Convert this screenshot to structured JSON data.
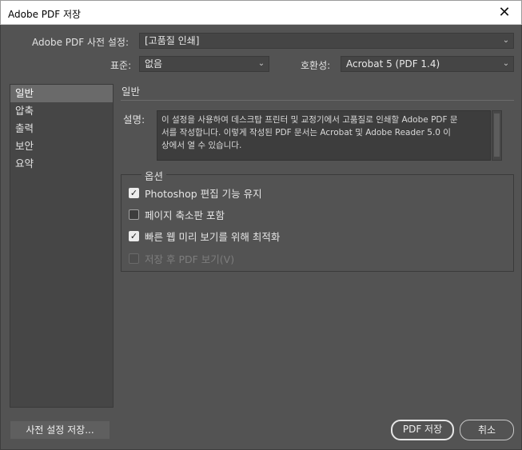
{
  "window": {
    "title": "Adobe PDF 저장",
    "close_glyph": "✕"
  },
  "preset": {
    "label": "Adobe PDF 사전 설정:",
    "value": "[고품질 인쇄]"
  },
  "standard": {
    "label": "표준:",
    "value": "없음"
  },
  "compatibility": {
    "label": "호환성:",
    "value": "Acrobat 5 (PDF 1.4)"
  },
  "sidebar": {
    "items": [
      {
        "label": "일반",
        "selected": true
      },
      {
        "label": "압축",
        "selected": false
      },
      {
        "label": "출력",
        "selected": false
      },
      {
        "label": "보안",
        "selected": false
      },
      {
        "label": "요약",
        "selected": false
      }
    ]
  },
  "general": {
    "title": "일반",
    "description_label": "설명:",
    "description_lines": [
      "이 설정을 사용하여 데스크탑 프린터 및 교정기에서 고품질로 인쇄할 Adobe PDF 문",
      "서를 작성합니다. 이렇게 작성된 PDF 문서는 Acrobat 및 Adobe Reader 5.0 이",
      "상에서 열 수 있습니다."
    ]
  },
  "options": {
    "title": "옵션",
    "items": [
      {
        "label": "Photoshop 편집 기능 유지",
        "checked": true,
        "enabled": true
      },
      {
        "label": "페이지 축소판 포함",
        "checked": false,
        "enabled": true
      },
      {
        "label": "빠른 웹 미리 보기를 위해 최적화",
        "checked": true,
        "enabled": true
      },
      {
        "label": "저장 후 PDF 보기(V)",
        "checked": false,
        "enabled": false
      }
    ]
  },
  "footer": {
    "save_preset_label": "사전 설정 저장...",
    "save_pdf_label": "PDF 저장",
    "cancel_label": "취소"
  },
  "icons": {
    "chevron": "⌄",
    "check": "✓"
  }
}
